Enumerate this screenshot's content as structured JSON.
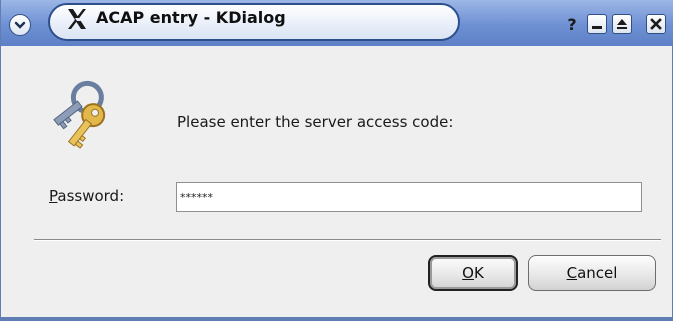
{
  "window": {
    "title": "ACAP entry - KDialog",
    "menu_icon": "chevron-down-icon",
    "app_icon": "x-logo-icon",
    "controls": {
      "help": "?",
      "help_icon": "help-icon",
      "minimize_icon": "minimize-icon",
      "maximize_icon": "maximize-icon",
      "close_icon": "close-icon"
    }
  },
  "dialog": {
    "icon": "keys-icon",
    "prompt": "Please enter the server access code:",
    "password": {
      "label_mnemonic": "P",
      "label_rest": "assword:",
      "value": "******"
    },
    "buttons": {
      "ok_mnemonic": "O",
      "ok_rest": "K",
      "cancel_mnemonic": "C",
      "cancel_rest": "ancel"
    }
  },
  "colors": {
    "titlebar": "#6e90d3",
    "frame": "#5f7fb4",
    "dialog_bg": "#efefef"
  }
}
